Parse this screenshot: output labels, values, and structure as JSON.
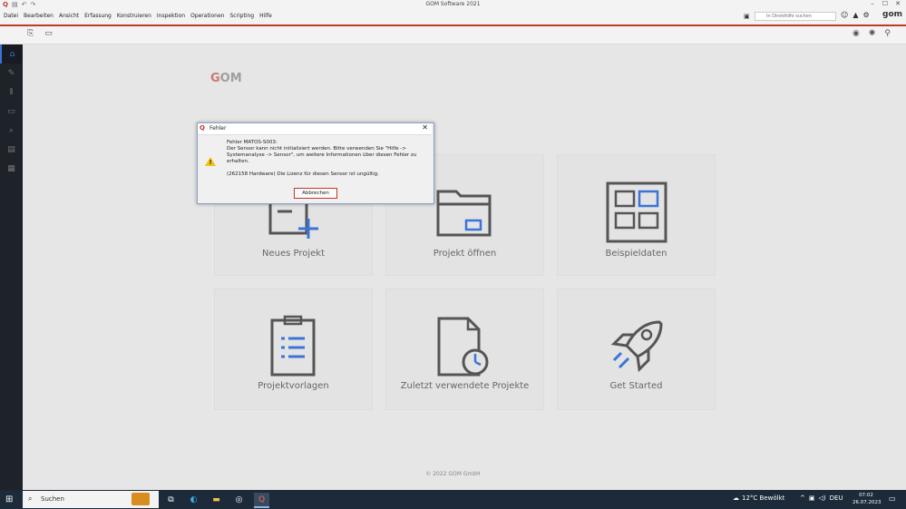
{
  "window": {
    "title": "GOM Software 2021",
    "controls": [
      "–",
      "☐",
      "✕"
    ],
    "quick_access": [
      "Q",
      "▤",
      "↶",
      "↷"
    ]
  },
  "menu": {
    "items": [
      "Datei",
      "Bearbeiten",
      "Ansicht",
      "Erfassung",
      "Konstruieren",
      "Inspektion",
      "Operationen",
      "Scripting",
      "Hilfe"
    ],
    "help_search_placeholder": "In Direkthilfe suchen",
    "logo_text": "gom"
  },
  "start": {
    "brand_prefix": "G",
    "brand_rest": "OM",
    "tiles": [
      {
        "label": "Neues Projekt",
        "icon": "new-project-icon"
      },
      {
        "label": "Projekt öffnen",
        "icon": "folder-open-icon"
      },
      {
        "label": "Beispieldaten",
        "icon": "example-data-icon"
      },
      {
        "label": "Projektvorlagen",
        "icon": "clipboard-icon"
      },
      {
        "label": "Zuletzt verwendete Projekte",
        "icon": "recent-file-icon"
      },
      {
        "label": "Get Started",
        "icon": "rocket-icon"
      }
    ],
    "copyright": "© 2022 GOM GmbH"
  },
  "dialog": {
    "title": "Fehler",
    "close": "✕",
    "line1": "Fehler MATOS-S003:",
    "line2": "Der Sensor kann nicht initialisiert werden. Bitte verwenden Sie \"Hilfe -> Systemanalyse -> Sensor\", um weitere Informationen über diesen Fehler zu erhalten.",
    "line3": "(262158 Hardware) Die Lizenz für diesen Sensor ist ungültig.",
    "button": "Abbrechen"
  },
  "taskbar": {
    "search_label": "Suchen",
    "weather": "12°C  Bewölkt",
    "lang": "DEU",
    "time": "07:02",
    "date": "26.07.2023"
  },
  "colors": {
    "accent": "#c0392b",
    "sidebar": "#1e2229",
    "taskbar": "#1c2a3a",
    "icon_blue": "#3b74d8"
  }
}
